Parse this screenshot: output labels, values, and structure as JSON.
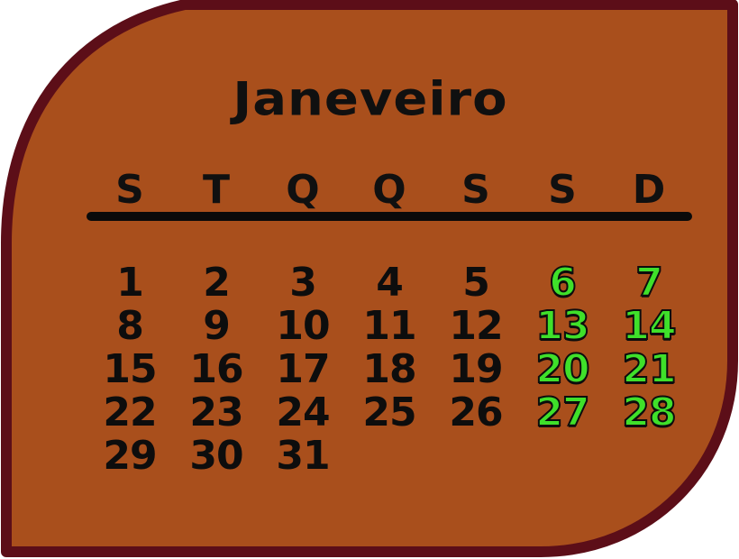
{
  "calendar": {
    "month": "Janeveiro",
    "weekdays": [
      "S",
      "T",
      "Q",
      "Q",
      "S",
      "S",
      "D"
    ],
    "days": [
      "1",
      "2",
      "3",
      "4",
      "5",
      "6",
      "7",
      "8",
      "9",
      "10",
      "11",
      "12",
      "13",
      "14",
      "15",
      "16",
      "17",
      "18",
      "19",
      "20",
      "21",
      "22",
      "23",
      "24",
      "25",
      "26",
      "27",
      "28",
      "29",
      "30",
      "31"
    ],
    "weekend_days": [
      "6",
      "7",
      "13",
      "14",
      "20",
      "21",
      "27",
      "28"
    ]
  },
  "colors": {
    "card_fill": "#a94f1c",
    "card_border": "#5c0e18",
    "text": "#0d0d0d",
    "weekend_text": "#3fe02a"
  }
}
